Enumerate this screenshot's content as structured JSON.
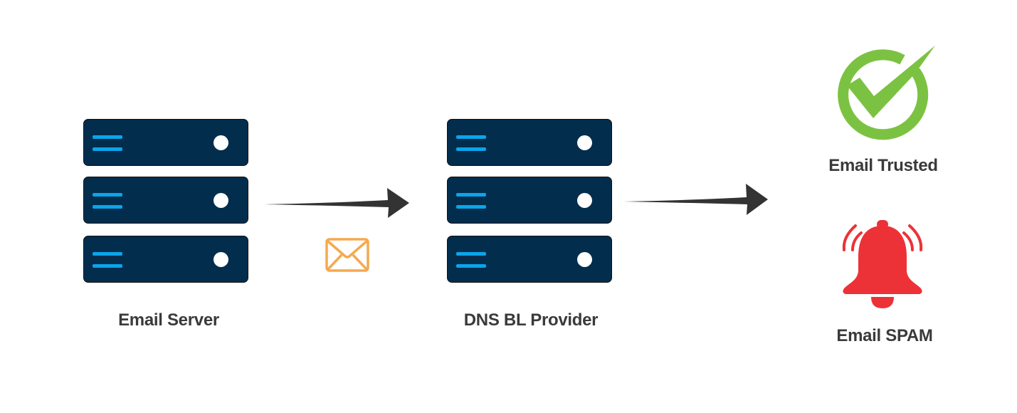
{
  "diagram": {
    "nodes": {
      "email_server": {
        "label": "Email Server",
        "icon": "server-rack-icon",
        "units": 3
      },
      "dns_bl_provider": {
        "label": "DNS BL Provider",
        "icon": "server-rack-icon",
        "units": 3
      },
      "email_trusted": {
        "label": "Email Trusted",
        "icon": "check-circle-icon"
      },
      "email_spam": {
        "label": "Email SPAM",
        "icon": "alarm-bell-icon"
      }
    },
    "edges": [
      {
        "from": "email_server",
        "to": "dns_bl_provider",
        "icon": "envelope-icon"
      },
      {
        "from": "dns_bl_provider",
        "to": "outcomes"
      }
    ],
    "colors": {
      "server_body": "#032d4d",
      "server_bars": "#0aa5ea",
      "server_led": "#ffffff",
      "arrow": "#333333",
      "envelope": "#f5a94e",
      "check": "#7cc242",
      "bell": "#ec3237",
      "label_text": "#3a3a3a"
    }
  }
}
